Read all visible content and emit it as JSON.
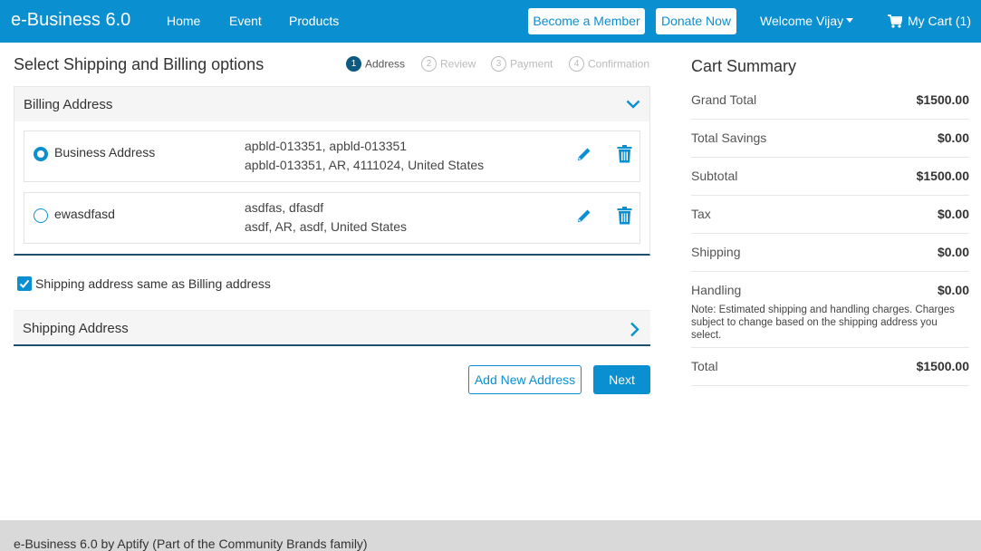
{
  "colors": {
    "primary": "#0a8fd0",
    "step_active": "#0d5a80",
    "panel_border": "#1d4f73",
    "footer_bg": "#d9d9d9"
  },
  "navbar": {
    "brand": "e-Business 6.0",
    "links": [
      "Home",
      "Event",
      "Products"
    ],
    "become_member": "Become a Member",
    "donate": "Donate Now",
    "welcome": "Welcome Vijay",
    "cart": "My Cart (1)"
  },
  "checkout": {
    "title": "Select Shipping and Billing options",
    "steps": [
      {
        "num": "1",
        "label": "Address",
        "active": true
      },
      {
        "num": "2",
        "label": "Review",
        "active": false
      },
      {
        "num": "3",
        "label": "Payment",
        "active": false
      },
      {
        "num": "4",
        "label": "Confirmation",
        "active": false
      }
    ],
    "billing": {
      "title": "Billing Address",
      "addresses": [
        {
          "name": "Business Address",
          "line1": "apbld-013351, apbld-013351",
          "line2": "apbld-013351, AR, 4111024, United States",
          "selected": true
        },
        {
          "name": "ewasdfasd",
          "line1": "asdfas, dfasdf",
          "line2": "asdf, AR, asdf, United States",
          "selected": false
        }
      ]
    },
    "same_as_billing": {
      "label": "Shipping address same as Billing address",
      "checked": true
    },
    "shipping": {
      "title": "Shipping Address"
    },
    "add_address": "Add New Address",
    "next": "Next"
  },
  "cart_summary": {
    "title": "Cart Summary",
    "rows": [
      {
        "label": "Grand Total",
        "value": "$1500.00"
      },
      {
        "label": "Total Savings",
        "value": "$0.00"
      },
      {
        "label": "Subtotal",
        "value": "$1500.00"
      },
      {
        "label": "Tax",
        "value": "$0.00"
      },
      {
        "label": "Shipping",
        "value": "$0.00"
      },
      {
        "label": "Handling",
        "value": "$0.00",
        "note": "Note: Estimated shipping and handling charges. Charges subject to change based on the shipping address you select."
      },
      {
        "label": "Total",
        "value": "$1500.00"
      }
    ]
  },
  "footer": {
    "text": "e-Business 6.0 by Aptify (Part of the Community Brands family)"
  }
}
